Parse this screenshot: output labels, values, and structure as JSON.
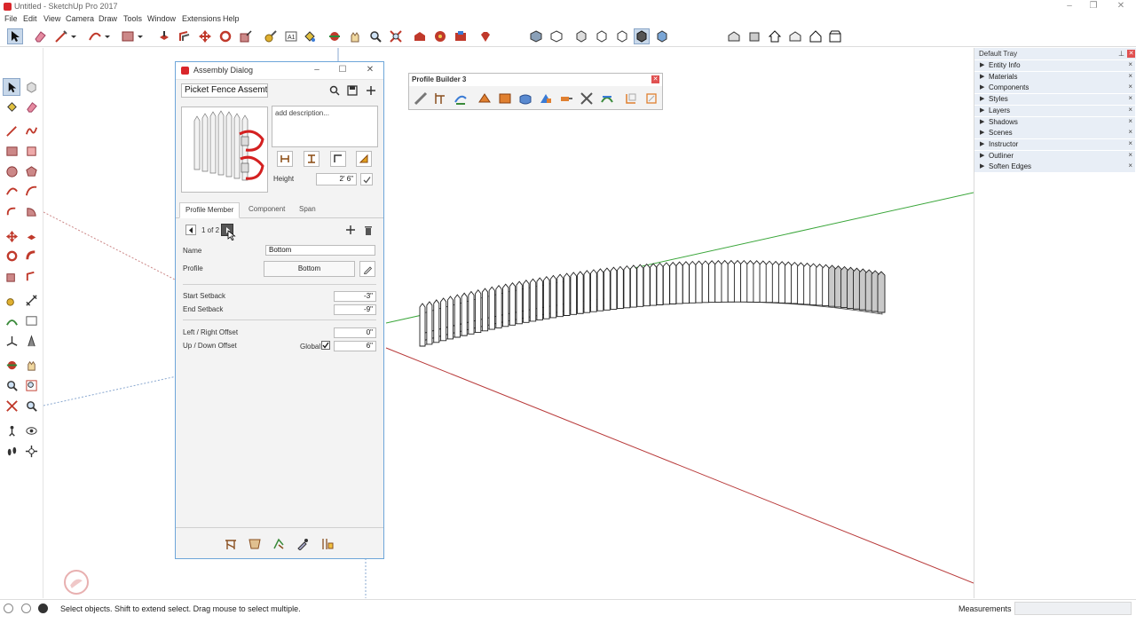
{
  "window": {
    "title": "Untitled - SketchUp Pro 2017",
    "controls": [
      "–",
      "❐",
      "✕"
    ]
  },
  "menu": [
    "File",
    "Edit",
    "View",
    "Camera",
    "Draw",
    "Tools",
    "Window",
    "Extensions",
    "Help"
  ],
  "assembly_dialog": {
    "title": "Assembly Dialog",
    "name_value": "Picket Fence Assemt",
    "description_placeholder": "add description...",
    "height_label": "Height",
    "height_value": "2' 6\"",
    "tabs": [
      {
        "label": "Profile Member",
        "active": true
      },
      {
        "label": "Component",
        "active": false
      },
      {
        "label": "Span",
        "active": false
      }
    ],
    "member_counter": "1 of 2",
    "name_label": "Name",
    "name_field_value": "Bottom",
    "profile_label": "Profile",
    "profile_value": "Bottom",
    "start_setback_label": "Start Setback",
    "start_setback_value": "-3\"",
    "end_setback_label": "End Setback",
    "end_setback_value": "-9\"",
    "lr_offset_label": "Left / Right Offset",
    "lr_offset_value": "0\"",
    "ud_offset_label": "Up / Down Offset",
    "global_label": "Global",
    "global_checked": true,
    "ud_offset_value": "6\""
  },
  "profile_builder": {
    "title": "Profile Builder 3"
  },
  "tray": {
    "title": "Default Tray",
    "items": [
      "Entity Info",
      "Materials",
      "Components",
      "Styles",
      "Layers",
      "Shadows",
      "Scenes",
      "Instructor",
      "Outliner",
      "Soften Edges"
    ]
  },
  "status": {
    "message": "Select objects. Shift to extend select. Drag mouse to select multiple.",
    "measurements_label": "Measurements",
    "measurements_value": ""
  },
  "colors": {
    "accent_red": "#d9262b",
    "axis_green": "#3aa63a",
    "axis_red": "#b83a3a",
    "dialog_border": "#6ea6d9"
  }
}
